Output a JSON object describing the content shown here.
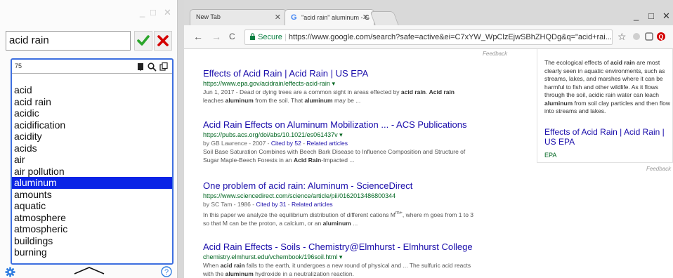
{
  "panel": {
    "minimize_glyph": "_",
    "maximize_glyph": "□",
    "close_glyph": "✕",
    "entry_value": "acid rain",
    "ok_glyph": "✔",
    "cancel_glyph": "✖",
    "list_count": "75",
    "words": [
      "acid",
      "acid rain",
      "acidic",
      "acidification",
      "acidity",
      "acids",
      "air",
      "air pollution",
      "aluminum",
      "amounts",
      "aquatic",
      "atmosphere",
      "atmospheric",
      "buildings",
      "burning"
    ],
    "selected_word": "aluminum",
    "help_glyph": "?",
    "colors": {
      "selection": "#0a24e6",
      "frame": "#3d6fe0",
      "ok": "#2aa52a",
      "cancel": "#d40000",
      "footer_icon": "#2f7de1"
    }
  },
  "browser": {
    "tabs": [
      {
        "label": "New Tab"
      },
      {
        "label": "\"acid rain\" aluminum - G"
      }
    ],
    "tab_close_glyph": "✕",
    "minimize_glyph": "_",
    "maximize_glyph": "□",
    "close_glyph": "✕",
    "nav": {
      "back": "←",
      "forward": "→",
      "reload": "C"
    },
    "secure_label": "Secure",
    "address": "https://www.google.com/search?safe=active&ei=C7xYW_WpClzEjwSBhZHQDg&q=\"acid+rai...",
    "star_glyph": "☆",
    "menu_glyph": "⋮"
  },
  "page": {
    "feedback_top": "Feedback",
    "results": [
      {
        "title": "Effects of Acid Rain | Acid Rain | US EPA",
        "url": "https://www.epa.gov/acidrain/effects-acid-rain",
        "snippet_line1": "Jun 1, 2017 - Dead or dying trees are a common sight in areas effected by <b>acid rain</b>. <b>Acid rain</b>",
        "snippet_line2": "leaches <b>aluminum</b> from the soil. That <b>aluminum</b> may be ..."
      },
      {
        "title": "Acid Rain Effects on Aluminum Mobilization ... - ACS Publications",
        "url": "https://pubs.acs.org/doi/abs/10.1021/es061437v",
        "meta_prefix": "by GB Lawrence - 2007 - ",
        "cited": "Cited by 52",
        "related": "Related articles",
        "snippet_line1": "Soil Base Saturation Combines with Beech Bark Disease to Influence Composition and Structure of",
        "snippet_line2": "Sugar Maple-Beech Forests in an <b>Acid Rain</b>-Impacted ..."
      },
      {
        "title": "One problem of acid rain: Aluminum - ScienceDirect",
        "url": "https://www.sciencedirect.com/science/article/pii/0162013486800344",
        "meta_prefix": "by SC Tam - 1986 - ",
        "cited": "Cited by 31",
        "related": "Related articles",
        "snippet_line1": "In this paper we analyze the equilibrium distribution of different cations M<sup>m+</sup>, where m goes from 1 to 3",
        "snippet_line2": "so that M can be the proton, a calcium, or an <b>aluminum</b> ..."
      },
      {
        "title": "Acid Rain Effects - Soils - Chemistry@Elmhurst - Elmhurst College",
        "url": "chemistry.elmhurst.edu/vchembook/196soil.html",
        "snippet_line1": "When <b>acid rain</b> falls to the earth, it undergoes a new round of physical and ... The sulfuric acid reacts",
        "snippet_line2": "with the <b>aluminum</b> hydroxide in a neutralization reaction."
      }
    ],
    "knowledge_panel": {
      "text": "The ecological effects of <b>acid rain</b> are most clearly seen in aquatic environments, such as streams, lakes, and marshes where it can be harmful to fish and other wildlife. As it flows through the soil, acidic rain water can leach <b>aluminum</b> from soil clay particles and then flow into streams and lakes.",
      "link": "Effects of Acid Rain | Acid Rain | US EPA",
      "source": "EPA"
    },
    "feedback_side": "Feedback"
  }
}
